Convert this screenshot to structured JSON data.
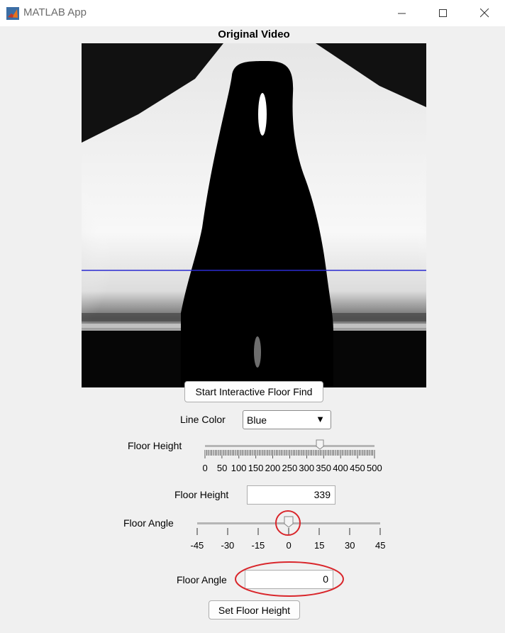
{
  "window": {
    "title": "MATLAB App",
    "icons": [
      "matlab-logo-icon",
      "minimize-icon",
      "maximize-icon",
      "close-icon"
    ]
  },
  "video": {
    "title": "Original Video",
    "overlay_line_color": "#2a2ad0"
  },
  "buttons": {
    "start_floor_find": "Start Interactive Floor Find",
    "set_floor_height": "Set Floor Height"
  },
  "line_color": {
    "label": "Line Color",
    "selected": "Blue",
    "arrow": "▼"
  },
  "floor_height_slider": {
    "label": "Floor Height",
    "value": 339,
    "min": 0,
    "max": 500,
    "major_ticks": [
      "0",
      "50",
      "100",
      "150",
      "200",
      "250",
      "300",
      "350",
      "400",
      "450",
      "500"
    ]
  },
  "floor_height_field": {
    "label": "Floor Height",
    "value": "339"
  },
  "floor_angle_slider": {
    "label": "Floor Angle",
    "value": 0,
    "min": -45,
    "max": 45,
    "major_ticks": [
      "-45",
      "-30",
      "-15",
      "0",
      "15",
      "30",
      "45"
    ]
  },
  "floor_angle_field": {
    "label": "Floor Angle",
    "value": "0"
  },
  "annotation_color": "#d9262b"
}
